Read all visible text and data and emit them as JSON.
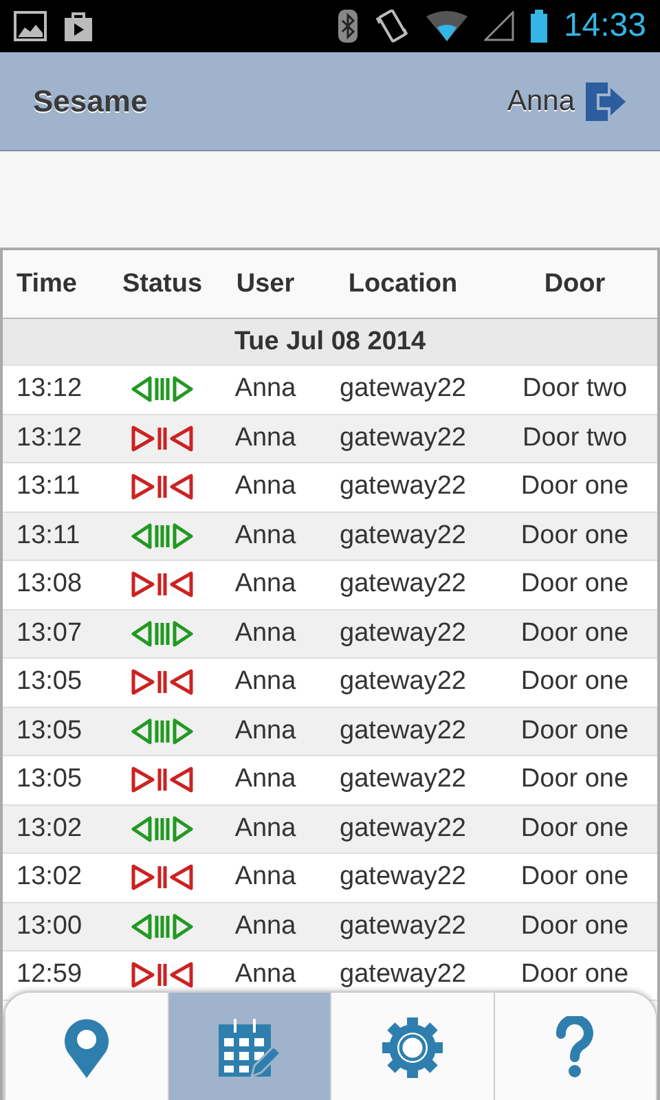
{
  "status_bar": {
    "time": "14:33"
  },
  "header": {
    "title": "Sesame",
    "user": "Anna"
  },
  "table": {
    "columns": [
      "Time",
      "Status",
      "User",
      "Location",
      "Door"
    ],
    "date": "Tue Jul 08 2014",
    "rows": [
      {
        "time": "13:12",
        "kind": "open",
        "user": "Anna",
        "location": "gateway22",
        "door": "Door two"
      },
      {
        "time": "13:12",
        "kind": "closed",
        "user": "Anna",
        "location": "gateway22",
        "door": "Door two"
      },
      {
        "time": "13:11",
        "kind": "closed",
        "user": "Anna",
        "location": "gateway22",
        "door": "Door one"
      },
      {
        "time": "13:11",
        "kind": "open",
        "user": "Anna",
        "location": "gateway22",
        "door": "Door one"
      },
      {
        "time": "13:08",
        "kind": "closed",
        "user": "Anna",
        "location": "gateway22",
        "door": "Door one"
      },
      {
        "time": "13:07",
        "kind": "open",
        "user": "Anna",
        "location": "gateway22",
        "door": "Door one"
      },
      {
        "time": "13:05",
        "kind": "closed",
        "user": "Anna",
        "location": "gateway22",
        "door": "Door one"
      },
      {
        "time": "13:05",
        "kind": "open",
        "user": "Anna",
        "location": "gateway22",
        "door": "Door one"
      },
      {
        "time": "13:05",
        "kind": "closed",
        "user": "Anna",
        "location": "gateway22",
        "door": "Door one"
      },
      {
        "time": "13:02",
        "kind": "open",
        "user": "Anna",
        "location": "gateway22",
        "door": "Door one"
      },
      {
        "time": "13:02",
        "kind": "closed",
        "user": "Anna",
        "location": "gateway22",
        "door": "Door one"
      },
      {
        "time": "13:00",
        "kind": "open",
        "user": "Anna",
        "location": "gateway22",
        "door": "Door one"
      },
      {
        "time": "12:59",
        "kind": "closed",
        "user": "Anna",
        "location": "gateway22",
        "door": "Door one"
      }
    ]
  },
  "nav": [
    {
      "kind": "location",
      "selected": false
    },
    {
      "kind": "log",
      "selected": true
    },
    {
      "kind": "settings",
      "selected": false
    },
    {
      "kind": "help",
      "selected": false
    }
  ]
}
